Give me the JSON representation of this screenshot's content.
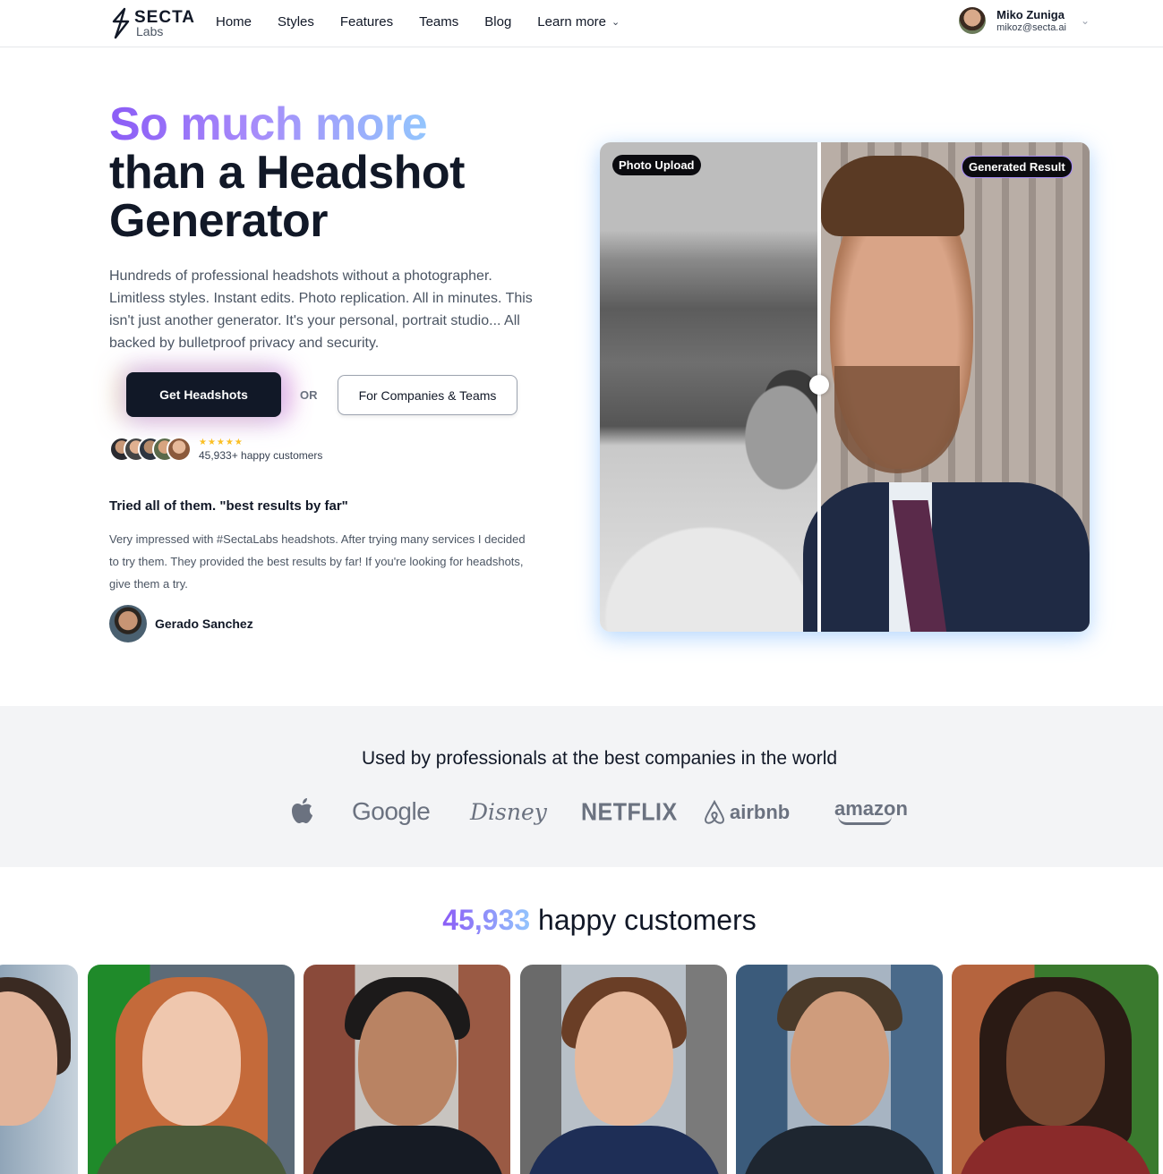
{
  "nav": {
    "logo_name": "SECTA",
    "logo_sub": "Labs",
    "links": [
      "Home",
      "Styles",
      "Features",
      "Teams",
      "Blog"
    ],
    "learn_more": "Learn more",
    "user_name": "Miko Zuniga",
    "user_email": "mikoz@secta.ai"
  },
  "hero": {
    "title_highlight": "So much more",
    "title_line2": "than a Headshot",
    "title_line3": "Generator",
    "description": "Hundreds of professional headshots without a photographer. Limitless styles. Instant edits. Photo replication. All in minutes. This isn't just another generator. It's your personal, portrait studio... All backed by bulletproof privacy and security.",
    "primary_button": "Get Headshots",
    "or_text": "OR",
    "secondary_button": "For Companies & Teams",
    "stars": "★★★★★",
    "customer_count_text": "45,933+ happy customers"
  },
  "testimonial": {
    "title": "Tried all of them. \"best results by far\"",
    "body": "Very impressed with #SectaLabs headshots. After trying many services I decided to try them. They provided the best results by far! If you're looking for headshots, give them a try.",
    "author": "Gerado Sanchez"
  },
  "compare": {
    "left_tag": "Photo Upload",
    "right_tag": "Generated Result"
  },
  "companies": {
    "title": "Used by professionals at the best companies in the world",
    "logos": [
      "Google",
      "Disney",
      "NETFLIX",
      "airbnb",
      "amazon"
    ]
  },
  "customers": {
    "count": "45,933",
    "label": "happy customers"
  },
  "colors": {
    "accent_purple": "#8b5cf6",
    "accent_blue": "#93c5fd",
    "dark": "#111827",
    "band_bg": "#f3f4f6"
  }
}
